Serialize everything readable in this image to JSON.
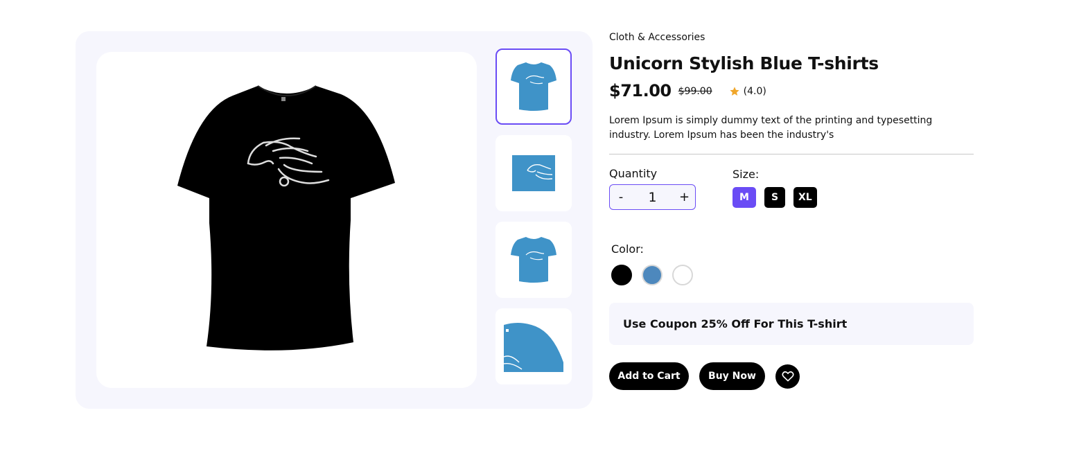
{
  "product": {
    "category": "Cloth & Accessories",
    "title": "Unicorn Stylish Blue T-shirts",
    "price": "$71.00",
    "old_price": "$99.00",
    "rating": "(4.0)",
    "description": "Lorem Ipsum is simply dummy text of the printing and typesetting industry. Lorem Ipsum has been the industry's"
  },
  "quantity": {
    "label": "Quantity",
    "minus": "-",
    "value": "1",
    "plus": "+"
  },
  "size": {
    "label": "Size:",
    "options": [
      "M",
      "S",
      "XL"
    ],
    "selected": "M"
  },
  "color": {
    "label": "Color:",
    "options": [
      "#000000",
      "#4d88bd",
      "#ffffff"
    ]
  },
  "coupon": "Use Coupon 25% Off For This T-shirt",
  "actions": {
    "add_to_cart": "Add to Cart",
    "buy_now": "Buy Now"
  },
  "colors": {
    "accent": "#6a4cf5",
    "shirt_blue": "#3f93c8",
    "star": "#f0a62a",
    "panel": "#f6f6fd"
  },
  "icons": {
    "rating": "star-icon",
    "wishlist": "heart-icon"
  }
}
